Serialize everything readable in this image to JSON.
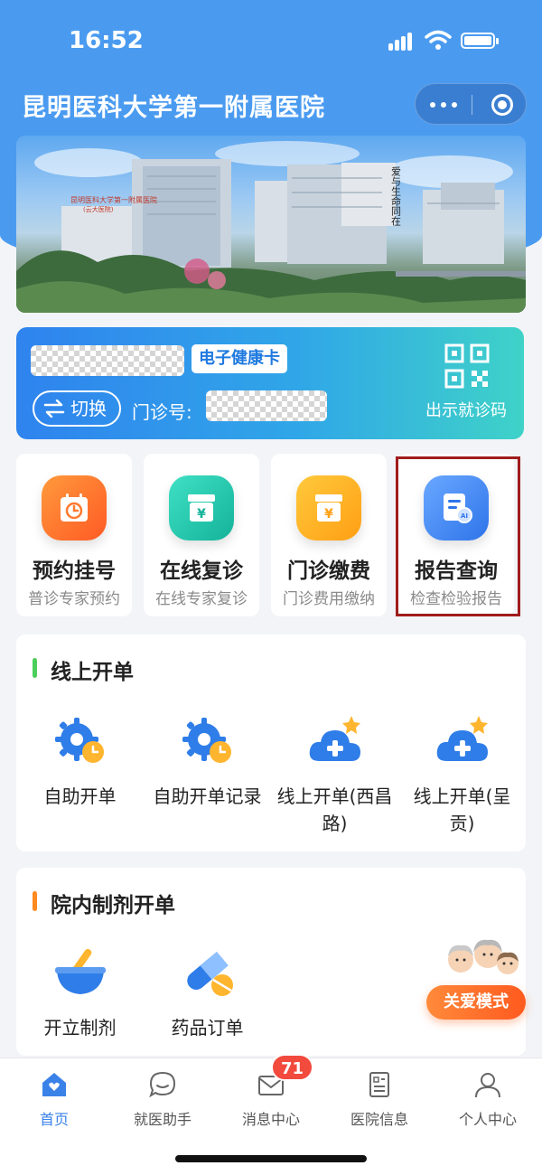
{
  "status_bar": {
    "time": "16:52"
  },
  "header": {
    "title": "昆明医科大学第一附属医院"
  },
  "banner": {
    "hospital_sign": "昆明医科大学第一附属医院",
    "hospital_sign_sub": "(云大医院)",
    "slogan": "爱与生命同在"
  },
  "health_card": {
    "tag": "电子健康卡",
    "switch_label": "切换",
    "clinic_no_label": "门诊号:",
    "qr_label": "出示就诊码"
  },
  "services": [
    {
      "title": "预约挂号",
      "subtitle": "普诊专家预约"
    },
    {
      "title": "在线复诊",
      "subtitle": "在线专家复诊"
    },
    {
      "title": "门诊缴费",
      "subtitle": "门诊费用缴纳"
    },
    {
      "title": "报告查询",
      "subtitle": "检查检验报告"
    }
  ],
  "online_orders": {
    "title": "线上开单",
    "items": [
      {
        "label": "自助开单"
      },
      {
        "label": "自助开单记录"
      },
      {
        "label": "线上开单(西昌路)"
      },
      {
        "label": "线上开单(呈贡)"
      }
    ]
  },
  "preparations": {
    "title": "院内制剂开单",
    "items": [
      {
        "label": "开立制剂"
      },
      {
        "label": "药品订单"
      }
    ]
  },
  "care_mode": {
    "label": "关爱模式"
  },
  "tabbar": {
    "items": [
      {
        "label": "首页"
      },
      {
        "label": "就医助手"
      },
      {
        "label": "消息中心"
      },
      {
        "label": "医院信息"
      },
      {
        "label": "个人中心"
      }
    ],
    "message_badge": "71"
  },
  "colors": {
    "primary": "#4a9bf0",
    "active_tab": "#3b82e8",
    "badge": "#f24a3d",
    "highlight_box": "#a01c1c",
    "online_orders_mark": "#4ccf5a",
    "preparations_mark": "#ff8a1f"
  }
}
